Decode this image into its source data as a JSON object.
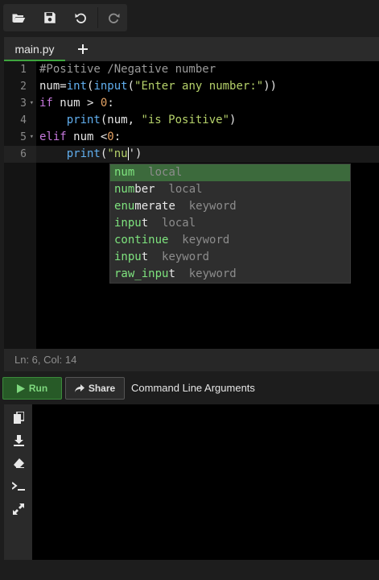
{
  "toolbar": {
    "buttons": [
      {
        "icon": "folder-open-icon"
      },
      {
        "icon": "save-icon"
      },
      {
        "icon": "undo-icon"
      },
      {
        "icon": "redo-icon"
      }
    ]
  },
  "tabs": {
    "active": "main.py",
    "add_label": "+"
  },
  "editor": {
    "gutter": [
      "1",
      "2",
      "3",
      "4",
      "5",
      "6"
    ],
    "lines": [
      {
        "segments": [
          {
            "text": "#Positive /Negative number",
            "cls": "t-com"
          }
        ]
      },
      {
        "segments": [
          {
            "text": "num=",
            "cls": ""
          },
          {
            "text": "int",
            "cls": "t-fn"
          },
          {
            "text": "(",
            "cls": ""
          },
          {
            "text": "input",
            "cls": "t-fn"
          },
          {
            "text": "(",
            "cls": ""
          },
          {
            "text": "\"Enter any number:\"",
            "cls": "t-str"
          },
          {
            "text": "))",
            "cls": ""
          }
        ]
      },
      {
        "segments": [
          {
            "text": "if",
            "cls": "t-kw"
          },
          {
            "text": " num > ",
            "cls": ""
          },
          {
            "text": "0",
            "cls": "t-num"
          },
          {
            "text": ":",
            "cls": ""
          }
        ]
      },
      {
        "segments": [
          {
            "text": "    ",
            "cls": ""
          },
          {
            "text": "print",
            "cls": "t-fn"
          },
          {
            "text": "(num, ",
            "cls": ""
          },
          {
            "text": "\"is Positive\"",
            "cls": "t-str"
          },
          {
            "text": ")",
            "cls": ""
          }
        ]
      },
      {
        "segments": [
          {
            "text": "elif",
            "cls": "t-kw"
          },
          {
            "text": " num <",
            "cls": ""
          },
          {
            "text": "0",
            "cls": "t-num"
          },
          {
            "text": ":",
            "cls": ""
          }
        ]
      },
      {
        "segments": [
          {
            "text": "    ",
            "cls": ""
          },
          {
            "text": "print",
            "cls": "t-fn"
          },
          {
            "text": "(",
            "cls": ""
          },
          {
            "text": "\"nu",
            "cls": "t-str"
          },
          {
            "text": "CURSOR",
            "cls": "cursor"
          },
          {
            "text": "')",
            "cls": ""
          }
        ]
      }
    ]
  },
  "autocomplete": {
    "items": [
      {
        "match": "num",
        "rest": "",
        "meta": "local",
        "selected": true
      },
      {
        "match": "num",
        "rest": "ber",
        "meta": "local",
        "selected": false
      },
      {
        "match": "e",
        "rest": "",
        "rest_mid": "nu",
        "rest2": "merate",
        "meta": "keyword",
        "selected": false
      },
      {
        "match": "in",
        "rest": "",
        "rest_mid": "pu",
        "rest2": "t",
        "meta": "local",
        "selected": false
      },
      {
        "match": "conti",
        "rest": "",
        "rest_mid": "nue",
        "rest2": "",
        "meta": "keyword",
        "selected": false
      },
      {
        "match": "in",
        "rest": "",
        "rest_mid": "pu",
        "rest2": "t",
        "meta": "keyword",
        "selected": false
      },
      {
        "match": "raw_in",
        "rest": "",
        "rest_mid": "pu",
        "rest2": "t",
        "meta": "keyword",
        "selected": false
      }
    ]
  },
  "status": {
    "position": "Ln: 6,  Col: 14"
  },
  "runbar": {
    "run_label": "Run",
    "share_label": "Share",
    "cmd_label": "Command Line Arguments"
  },
  "console_tools": [
    {
      "icon": "copy-icon"
    },
    {
      "icon": "download-icon"
    },
    {
      "icon": "eraser-icon"
    },
    {
      "icon": "terminal-icon"
    },
    {
      "icon": "expand-icon"
    }
  ]
}
